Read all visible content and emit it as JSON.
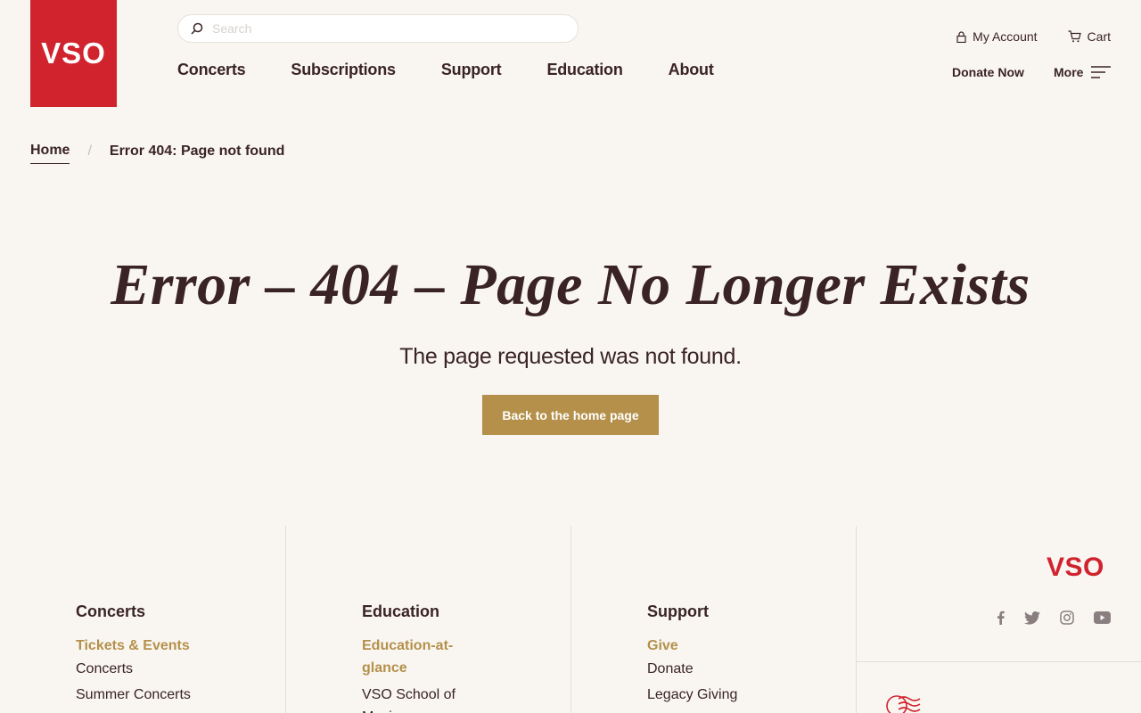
{
  "brand": {
    "logo_text": "VSO",
    "color": "#d1232e",
    "accent": "#b4904a"
  },
  "search": {
    "placeholder": "Search"
  },
  "nav": {
    "items": [
      "Concerts",
      "Subscriptions",
      "Support",
      "Education",
      "About"
    ]
  },
  "utility": {
    "account": "My Account",
    "cart": "Cart",
    "donate": "Donate Now",
    "more": "More"
  },
  "breadcrumb": {
    "home": "Home",
    "separator": "/",
    "current": "Error 404: Page not found"
  },
  "hero": {
    "title": "Error – 404 – Page No Longer Exists",
    "subtitle": "The page requested was not found.",
    "button": "Back to the home page"
  },
  "footer": {
    "logo_text": "VSO",
    "columns": [
      {
        "heading": "Concerts",
        "highlight": "Tickets & Events",
        "links": [
          "Concerts",
          "Summer Concerts"
        ]
      },
      {
        "heading": "Education",
        "highlight": "Education-at-glance",
        "links": [
          "VSO School of Music"
        ]
      },
      {
        "heading": "Support",
        "highlight": "Give",
        "links": [
          "Donate",
          "Legacy Giving"
        ]
      }
    ],
    "social": [
      "facebook-icon",
      "twitter-icon",
      "instagram-icon",
      "youtube-icon"
    ]
  }
}
